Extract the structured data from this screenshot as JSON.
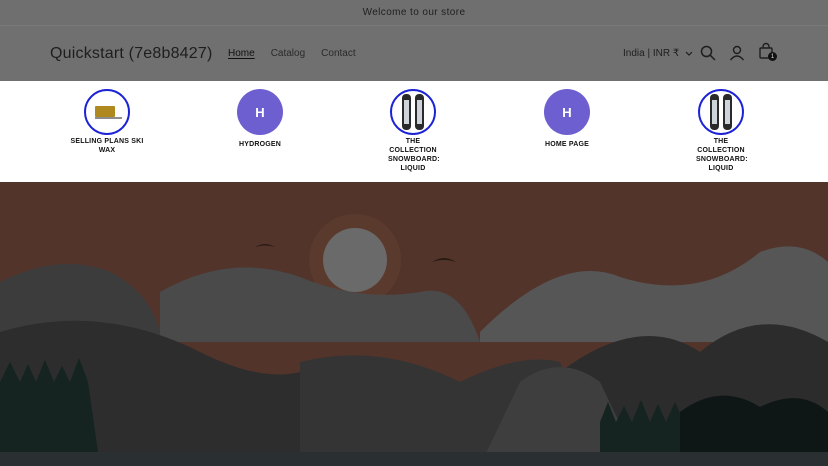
{
  "announcement": "Welcome to our store",
  "header": {
    "logo": "Quickstart (7e8b8427)",
    "nav": [
      "Home",
      "Catalog",
      "Contact"
    ],
    "locale": "India | INR ₹",
    "cart_count": "1",
    "icons": [
      "search-icon",
      "account-icon",
      "cart-icon",
      "chevron-down-icon"
    ]
  },
  "predictive_search": {
    "items": [
      {
        "label": "SELLING PLANS SKI WAX",
        "thumb": "ski-wax-image"
      },
      {
        "label": "HYDROGEN",
        "thumb": "letter",
        "letter": "H"
      },
      {
        "label": "THE COLLECTION SNOWBOARD: LIQUID",
        "thumb": "snowboard-image"
      },
      {
        "label": "HOME PAGE",
        "thumb": "letter",
        "letter": "H"
      },
      {
        "label": "THE COLLECTION SNOWBOARD: LIQUID",
        "thumb": "snowboard-image"
      }
    ]
  },
  "colors": {
    "overlay": "#3a3a3a",
    "accent_ring": "#1c22d6",
    "letter_avatar": "#6d5fd0"
  }
}
